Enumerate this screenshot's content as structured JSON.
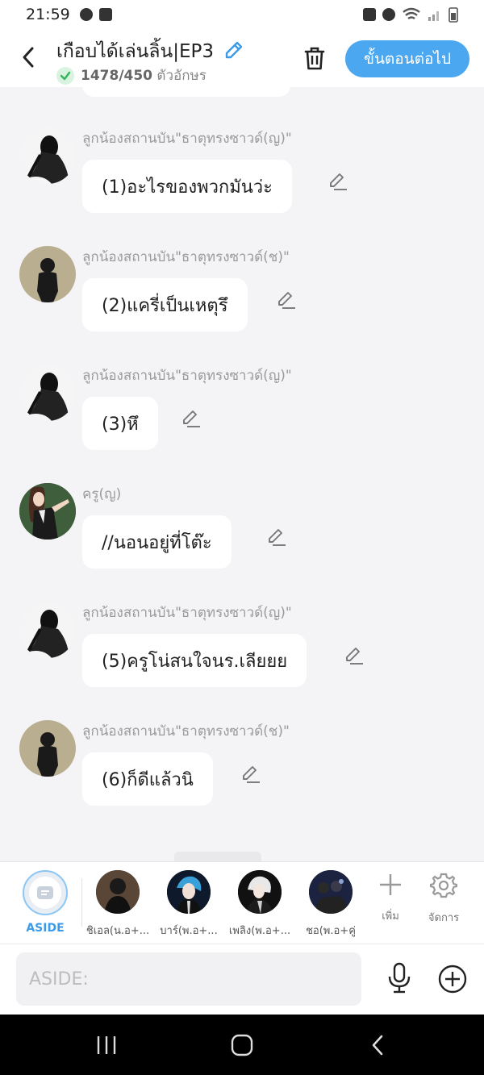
{
  "status_bar": {
    "time": "21:59"
  },
  "header": {
    "title": "เกือบได้เล่นลิ้น|EP3",
    "count_current": "1478/450",
    "count_unit": "ตัวอักษร",
    "next_label": "ขั้นตอนต่อไป"
  },
  "messages": [
    {
      "sender": "ลูกน้องสถานบัน\"ธาตุทรงซาวด์(ญ)\"",
      "text": "(1)อะไรของพวกมันว่ะ"
    },
    {
      "sender": "ลูกน้องสถานบัน\"ธาตุทรงซาวด์(ช)\"",
      "text": "(2)แครี่เป็นเหตุรึ"
    },
    {
      "sender": "ลูกน้องสถานบัน\"ธาตุทรงซาวด์(ญ)\"",
      "text": "(3)หึ"
    },
    {
      "sender": "ครู(ญ)",
      "text": "//นอนอยู่ที่โต๊ะ"
    },
    {
      "sender": "ลูกน้องสถานบัน\"ธาตุทรงซาวด์(ญ)\"",
      "text": "(5)ครูโน่สนใจนร.เลียยย"
    },
    {
      "sender": "ลูกน้องสถานบัน\"ธาตุทรงซาวด์(ช)\"",
      "text": "(6)ก็ดีแล้วนิ"
    }
  ],
  "characters": {
    "aside_label": "ASIDE",
    "items": [
      {
        "label": "ชิเอล(น.อ+..."
      },
      {
        "label": "บาร์(พ.อ+..."
      },
      {
        "label": "เพลิง(พ.อ+..."
      },
      {
        "label": "ชอ(พ.อ+คู่"
      }
    ],
    "add_label": "เพิ่ม",
    "manage_label": "จัดการ"
  },
  "input": {
    "placeholder": "ASIDE:"
  },
  "colors": {
    "accent": "#4aa7f0",
    "aside_blue": "#3b9be8",
    "background": "#f4f4f6"
  }
}
